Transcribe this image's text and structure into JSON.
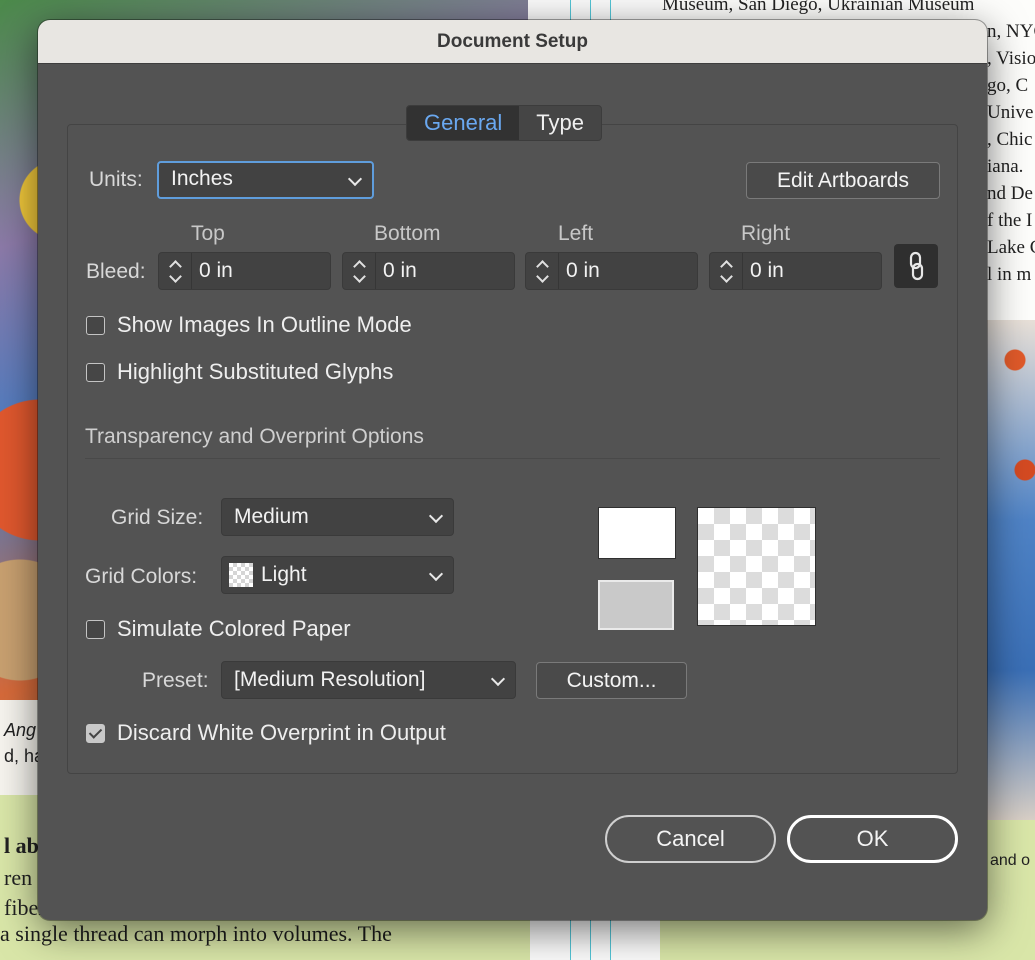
{
  "background": {
    "right_text_lines": [
      "Museum, San Diego, Ukrainian Museum",
      "n, NYC",
      ", Visio",
      "go, C",
      "Unive",
      ", Chic",
      "iana.",
      "nd De",
      "f the I",
      "Lake C",
      "l in m"
    ],
    "left_caption": [
      "Ang",
      "d, ha"
    ],
    "left_bottom_lines": [
      "l ab",
      "ren S",
      "fiber"
    ],
    "bottom_line": "a single thread can morph into volumes. The",
    "right_caption": "and o"
  },
  "dialog": {
    "title": "Document Setup",
    "tabs": [
      {
        "label": "General",
        "active": true
      },
      {
        "label": "Type",
        "active": false
      }
    ],
    "units": {
      "label": "Units:",
      "value": "Inches"
    },
    "edit_artboards_label": "Edit Artboards",
    "bleed": {
      "label": "Bleed:",
      "columns": [
        {
          "header": "Top",
          "value": "0 in"
        },
        {
          "header": "Bottom",
          "value": "0 in"
        },
        {
          "header": "Left",
          "value": "0 in"
        },
        {
          "header": "Right",
          "value": "0 in"
        }
      ]
    },
    "checkboxes": {
      "outline_mode": {
        "label": "Show Images In Outline Mode",
        "checked": false
      },
      "highlight_glyphs": {
        "label": "Highlight Substituted Glyphs",
        "checked": false
      },
      "simulate_paper": {
        "label": "Simulate Colored Paper",
        "checked": false
      },
      "discard_white": {
        "label": "Discard White Overprint in Output",
        "checked": true
      }
    },
    "transparency": {
      "section_title": "Transparency and Overprint Options",
      "grid_size": {
        "label": "Grid Size:",
        "value": "Medium"
      },
      "grid_colors": {
        "label": "Grid Colors:",
        "value": "Light"
      },
      "preset": {
        "label": "Preset:",
        "value": "[Medium Resolution]"
      },
      "custom_label": "Custom..."
    },
    "buttons": {
      "cancel": "Cancel",
      "ok": "OK"
    },
    "colors": {
      "accent": "#6aa8f0",
      "dialog_bg": "#535353",
      "focus_ring": "#5f9ddc"
    }
  }
}
